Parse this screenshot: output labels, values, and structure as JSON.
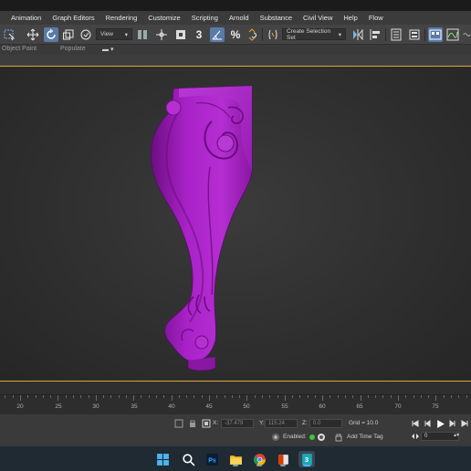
{
  "menubar": {
    "items": [
      "Animation",
      "Graph Editors",
      "Rendering",
      "Customize",
      "Scripting",
      "Arnold",
      "Substance",
      "Civil View",
      "Help",
      "Flow"
    ]
  },
  "toolbar": {
    "view_dropdown": "View",
    "angle_snap_label": "3",
    "selection_set_dropdown": "Create Selection Set"
  },
  "ribbon": {
    "object_paint": "Object Paint",
    "populate": "Populate"
  },
  "timeline": {
    "ticks": [
      "20",
      "25",
      "30",
      "35",
      "40",
      "45",
      "50",
      "55",
      "60",
      "65",
      "70",
      "75"
    ]
  },
  "status": {
    "x_label": "X:",
    "x_value": "-37.479",
    "y_label": "Y:",
    "y_value": "115.24",
    "z_label": "Z:",
    "z_value": "0.0",
    "grid": "Grid = 10.0",
    "enabled_label": "Enabled:",
    "add_time_tag": "Add Time Tag",
    "frame_value": "0"
  },
  "viewport": {
    "model_color": "#a21ec0"
  },
  "taskbar": {
    "icons": [
      "windows-start-icon",
      "search-icon",
      "photoshop-icon",
      "file-explorer-icon",
      "chrome-icon",
      "office-icon",
      "3dsmax-icon"
    ]
  }
}
